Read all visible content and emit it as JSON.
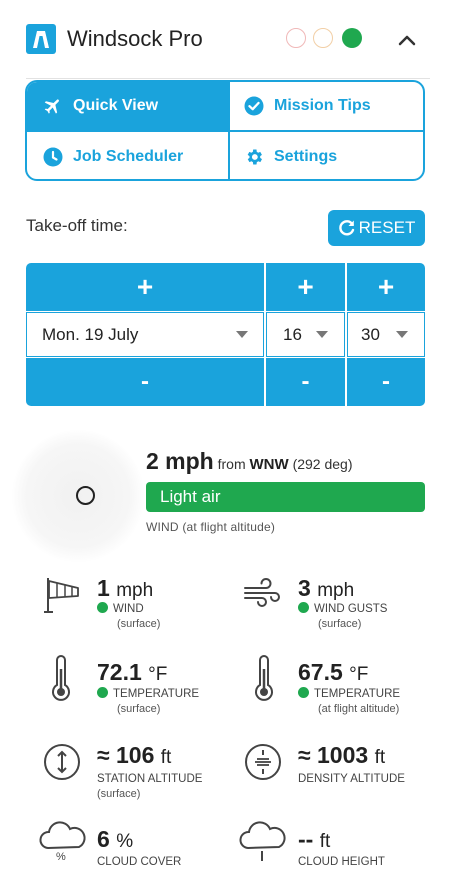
{
  "header": {
    "title": "Windsock Pro",
    "status_dots": [
      "#f6c9c9",
      "#f8dcc0",
      "#1fa84f"
    ]
  },
  "nav": {
    "quick_view": "Quick View",
    "mission_tips": "Mission Tips",
    "job_scheduler": "Job Scheduler",
    "settings": "Settings"
  },
  "takeoff": {
    "label": "Take-off time:",
    "reset": "RESET",
    "plus": "+",
    "minus": "-",
    "date": "Mon. 19 July",
    "hour": "16",
    "minute": "30"
  },
  "wind": {
    "speed": "2 mph",
    "from_text": "from",
    "direction": "WNW",
    "degrees": "(292 deg)",
    "condition": "Light air",
    "label": "WIND (at flight altitude)"
  },
  "metrics": {
    "wind_surface": {
      "value": "1",
      "unit": "mph",
      "label": "WIND",
      "sub": "(surface)"
    },
    "gusts": {
      "value": "3",
      "unit": "mph",
      "label": "WIND GUSTS",
      "sub": "(surface)"
    },
    "temp_surface": {
      "value": "72.1",
      "unit": "°F",
      "label": "TEMPERATURE",
      "sub": "(surface)"
    },
    "temp_altitude": {
      "value": "67.5",
      "unit": "°F",
      "label": "TEMPERATURE",
      "sub": "(at flight altitude)"
    },
    "station_alt": {
      "value": "≈ 106",
      "unit": "ft",
      "label": "STATION ALTITUDE",
      "sub": "(surface)"
    },
    "density_alt": {
      "value": "≈ 1003",
      "unit": "ft",
      "label": "DENSITY ALTITUDE"
    },
    "cloud_cover": {
      "value": "6",
      "unit": "%",
      "label": "CLOUD COVER"
    },
    "cloud_height": {
      "value": "--",
      "unit": "ft",
      "label": "CLOUD HEIGHT"
    }
  }
}
